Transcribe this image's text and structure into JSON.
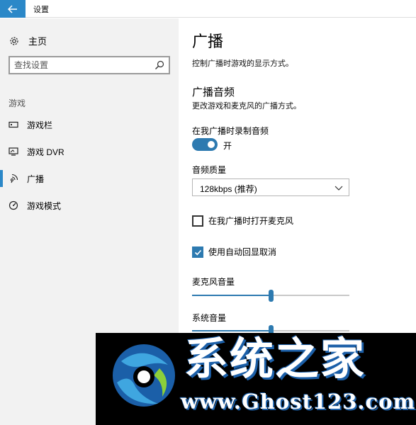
{
  "window": {
    "title": "设置",
    "back_icon": "arrow-left-icon",
    "accent_color": "#2b88c8"
  },
  "sidebar": {
    "home_label": "主页",
    "home_icon": "gear-icon",
    "search_placeholder": "查找设置",
    "section_label": "游戏",
    "items": [
      {
        "label": "游戏栏",
        "icon": "game-bar-icon",
        "selected": false
      },
      {
        "label": "游戏 DVR",
        "icon": "dvr-icon",
        "selected": false
      },
      {
        "label": "广播",
        "icon": "broadcast-icon",
        "selected": true
      },
      {
        "label": "游戏模式",
        "icon": "game-mode-icon",
        "selected": false
      }
    ]
  },
  "main": {
    "title": "广播",
    "description": "控制广播时游戏的显示方式。",
    "audio_section": {
      "title": "广播音频",
      "description": "更改游戏和麦克风的广播方式。",
      "record_audio_label": "在我广播时录制音频",
      "record_audio_state": "开",
      "record_audio_on": true,
      "quality_label": "音频质量",
      "quality_value": "128kbps (推荐)",
      "mic_checkbox_label": "在我广播时打开麦克风",
      "mic_checkbox_checked": false,
      "echo_checkbox_label": "使用自动回显取消",
      "echo_checkbox_checked": true,
      "mic_volume_label": "麦克风音量",
      "mic_volume": 0.5,
      "system_volume_label": "系统音量",
      "system_volume": 0.5
    }
  },
  "watermark": {
    "title": "系统之家",
    "url": "www.Ghost123.com"
  }
}
